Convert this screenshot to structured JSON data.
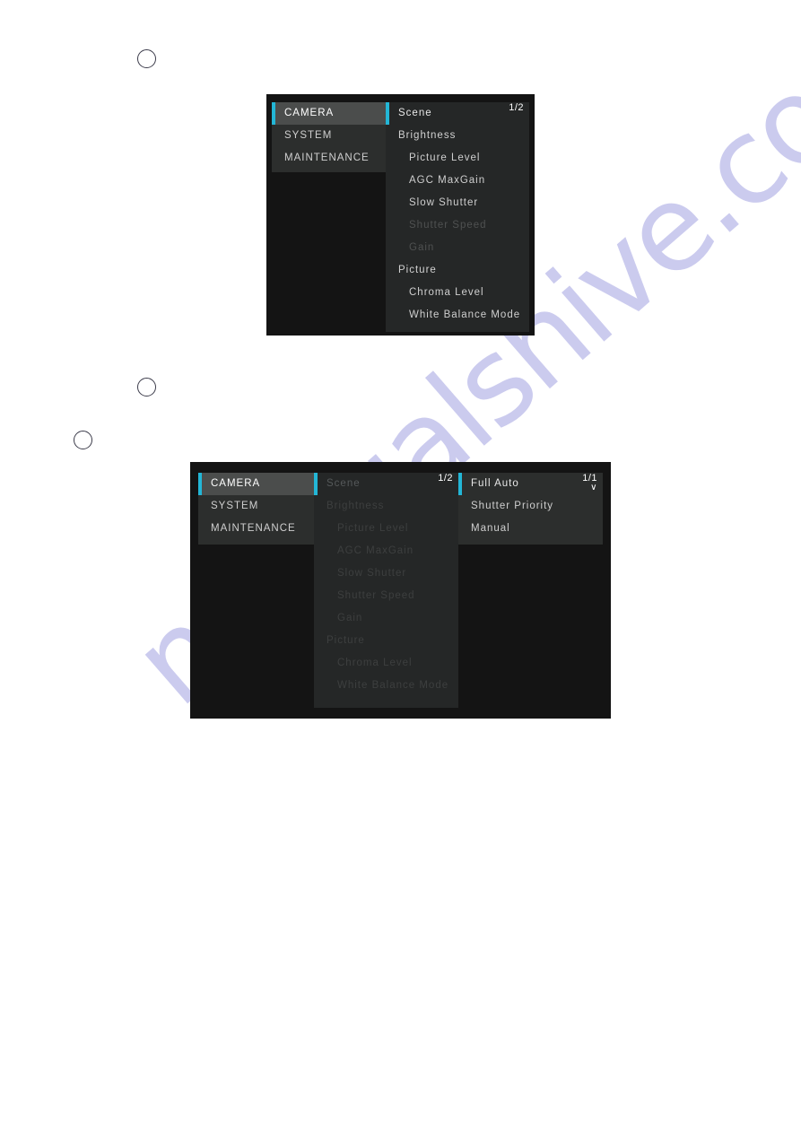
{
  "page": {
    "watermark": "manualshive.com",
    "watermark_color": "#c9c9ee",
    "accent_color": "#23b6d6",
    "background_color": "#ffffff"
  },
  "steps": [
    {
      "name": "step-marker-1",
      "label": ""
    },
    {
      "name": "step-marker-2",
      "label": ""
    },
    {
      "name": "step-marker-3",
      "label": ""
    }
  ],
  "osd1": {
    "name": "camera-osd-menu-page-1",
    "left_column": {
      "items": [
        {
          "label": "CAMERA",
          "selected": true
        },
        {
          "label": "SYSTEM",
          "selected": false
        },
        {
          "label": "MAINTENANCE",
          "selected": false
        }
      ]
    },
    "mid_column": {
      "page_indicator": "1/2",
      "items": [
        {
          "label": "Scene",
          "style": "selected",
          "indent": "main"
        },
        {
          "label": "Brightness",
          "style": "header",
          "indent": "main"
        },
        {
          "label": "Picture Level",
          "style": "sub",
          "indent": "sub"
        },
        {
          "label": "AGC MaxGain",
          "style": "sub",
          "indent": "sub"
        },
        {
          "label": "Slow Shutter",
          "style": "sub",
          "indent": "sub"
        },
        {
          "label": "Shutter Speed",
          "style": "dim",
          "indent": "sub"
        },
        {
          "label": "Gain",
          "style": "dim",
          "indent": "sub"
        },
        {
          "label": "Picture",
          "style": "header",
          "indent": "main"
        },
        {
          "label": "Chroma Level",
          "style": "sub",
          "indent": "sub"
        },
        {
          "label": "White Balance Mode",
          "style": "sub",
          "indent": "sub"
        }
      ]
    }
  },
  "osd2": {
    "name": "camera-osd-menu-scene-options",
    "left_column": {
      "items": [
        {
          "label": "CAMERA",
          "selected": true
        },
        {
          "label": "SYSTEM",
          "selected": false
        },
        {
          "label": "MAINTENANCE",
          "selected": false
        }
      ]
    },
    "mid_column": {
      "page_indicator": "1/2",
      "items": [
        {
          "label": "Scene",
          "style": "selected",
          "indent": "main"
        },
        {
          "label": "Brightness",
          "style": "faded",
          "indent": "main"
        },
        {
          "label": "Picture Level",
          "style": "faded",
          "indent": "sub"
        },
        {
          "label": "AGC MaxGain",
          "style": "faded",
          "indent": "sub"
        },
        {
          "label": "Slow Shutter",
          "style": "faded",
          "indent": "sub"
        },
        {
          "label": "Shutter Speed",
          "style": "faded",
          "indent": "sub"
        },
        {
          "label": "Gain",
          "style": "faded",
          "indent": "sub"
        },
        {
          "label": "Picture",
          "style": "faded",
          "indent": "main"
        },
        {
          "label": "Chroma Level",
          "style": "faded",
          "indent": "sub"
        },
        {
          "label": "White Balance Mode",
          "style": "faded",
          "indent": "sub"
        }
      ]
    },
    "right_column": {
      "page_indicator": "1/1",
      "page_chevron": "∨",
      "items": [
        {
          "label": "Full Auto",
          "style": "selected",
          "indent": "main"
        },
        {
          "label": "Shutter Priority",
          "style": "sub",
          "indent": "main"
        },
        {
          "label": "Manual",
          "style": "sub",
          "indent": "main"
        }
      ]
    }
  }
}
